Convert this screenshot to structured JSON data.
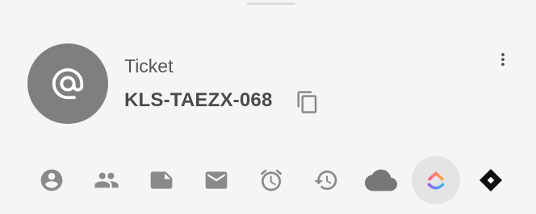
{
  "ticket": {
    "type_label": "Ticket",
    "id": "KLS-TAEZX-068"
  },
  "avatar": {
    "icon": "at-sign-icon"
  },
  "header_actions": {
    "copy": {
      "icon": "copy-icon"
    },
    "more": {
      "icon": "more-vertical-icon"
    }
  },
  "action_bar": {
    "items": [
      {
        "name": "contact",
        "icon": "account-circle-icon"
      },
      {
        "name": "group",
        "icon": "group-icon"
      },
      {
        "name": "note",
        "icon": "note-icon"
      },
      {
        "name": "email",
        "icon": "mail-icon"
      },
      {
        "name": "reminder",
        "icon": "alarm-icon"
      },
      {
        "name": "history",
        "icon": "history-icon"
      },
      {
        "name": "cloud",
        "icon": "cloud-icon"
      },
      {
        "name": "clickup",
        "icon": "clickup-logo-icon",
        "active": true
      },
      {
        "name": "linear",
        "icon": "diamond-logo-icon"
      }
    ]
  },
  "colors": {
    "background": "#f5f5f5",
    "icon_gray": "#8a8a8a",
    "avatar_bg": "#7f7f7f",
    "active_bg": "#e4e4e4"
  }
}
